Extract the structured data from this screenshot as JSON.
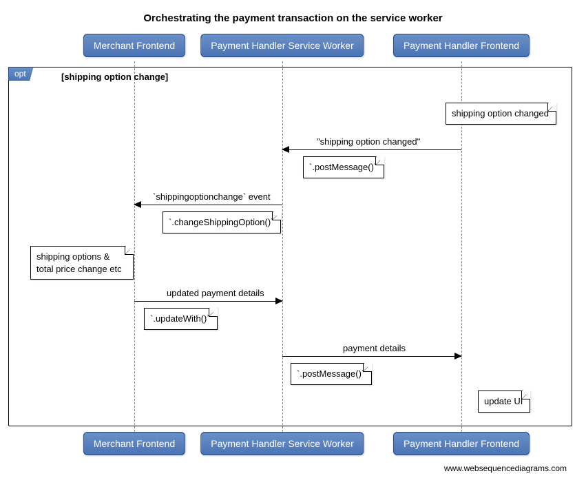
{
  "title": "Orchestrating the payment transaction on the service worker",
  "participants": {
    "merchant": "Merchant Frontend",
    "worker": "Payment Handler Service Worker",
    "frontend": "Payment Handler Frontend"
  },
  "frame": {
    "tag": "opt",
    "guard": "[shipping option change]"
  },
  "notes": {
    "shipping_changed": "shipping option changed",
    "post_message_1": "`.postMessage()`",
    "change_shipping_option": "`.changeShippingOption()`",
    "options_total": "shipping options & total price change etc",
    "update_with": "`.updateWith()`",
    "post_message_2": "`.postMessage()`",
    "update_ui": "update UI"
  },
  "messages": {
    "m1": "\"shipping option changed\"",
    "m2": "`shippingoptionchange` event",
    "m3": "updated payment details",
    "m4": "payment details"
  },
  "credit": "www.websequencediagrams.com",
  "chart_data": {
    "type": "sequence-diagram",
    "participants": [
      "Merchant Frontend",
      "Payment Handler Service Worker",
      "Payment Handler Frontend"
    ],
    "fragments": [
      {
        "type": "opt",
        "guard": "shipping option change",
        "steps": [
          {
            "kind": "note",
            "over": "Payment Handler Frontend",
            "text": "shipping option changed"
          },
          {
            "kind": "message",
            "from": "Payment Handler Frontend",
            "to": "Payment Handler Service Worker",
            "text": "\"shipping option changed\""
          },
          {
            "kind": "note",
            "over": "Payment Handler Service Worker",
            "text": "`.postMessage()`"
          },
          {
            "kind": "message",
            "from": "Payment Handler Service Worker",
            "to": "Merchant Frontend",
            "text": "`shippingoptionchange` event"
          },
          {
            "kind": "note",
            "over": "Payment Handler Service Worker",
            "text": "`.changeShippingOption()`"
          },
          {
            "kind": "note",
            "over": "Merchant Frontend",
            "text": "shipping options & total price change etc"
          },
          {
            "kind": "message",
            "from": "Merchant Frontend",
            "to": "Payment Handler Service Worker",
            "text": "updated payment details"
          },
          {
            "kind": "note",
            "over": "Merchant Frontend",
            "text": "`.updateWith()`"
          },
          {
            "kind": "message",
            "from": "Payment Handler Service Worker",
            "to": "Payment Handler Frontend",
            "text": "payment details"
          },
          {
            "kind": "note",
            "over": "Payment Handler Service Worker",
            "text": "`.postMessage()`"
          },
          {
            "kind": "note",
            "over": "Payment Handler Frontend",
            "text": "update UI"
          }
        ]
      }
    ]
  }
}
